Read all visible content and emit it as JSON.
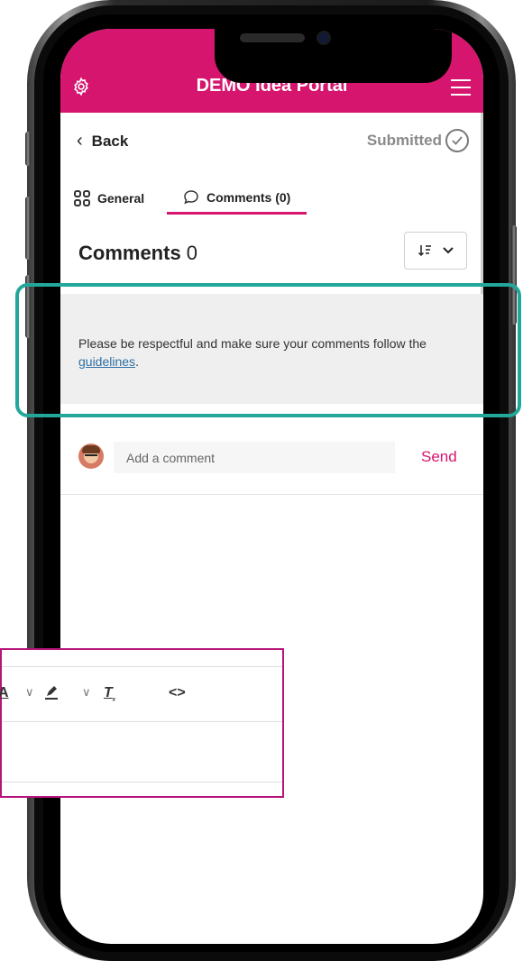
{
  "app": {
    "title": "DEMO Idea Portal",
    "accent_color": "#d6156e",
    "highlight_color": "#22a79a",
    "overlay_border_color": "#b5157a"
  },
  "icons": {
    "settings": "gear-icon",
    "menu": "hamburger-menu-icon",
    "back": "chevron-left-icon",
    "status": "check-circle-icon",
    "general_tab": "grid-icon",
    "comments_tab": "speech-bubble-icon",
    "sort": "sort-order-icon",
    "sort_dropdown": "chevron-down-icon"
  },
  "nav": {
    "back_label": "Back",
    "status_label": "Submitted"
  },
  "tabs": [
    {
      "label": "General",
      "active": false
    },
    {
      "label": "Comments (0)",
      "active": true
    }
  ],
  "comments": {
    "heading": "Comments",
    "count": "0",
    "notice_text": "Please be respectful and make sure your comments follow the ",
    "notice_link": "guidelines",
    "notice_suffix": ".",
    "input_placeholder": "Add a comment",
    "send_label": "Send"
  },
  "editor_toolbar": {
    "font_color_label": "A",
    "clear_format_label": "T",
    "code_label": "<>"
  }
}
